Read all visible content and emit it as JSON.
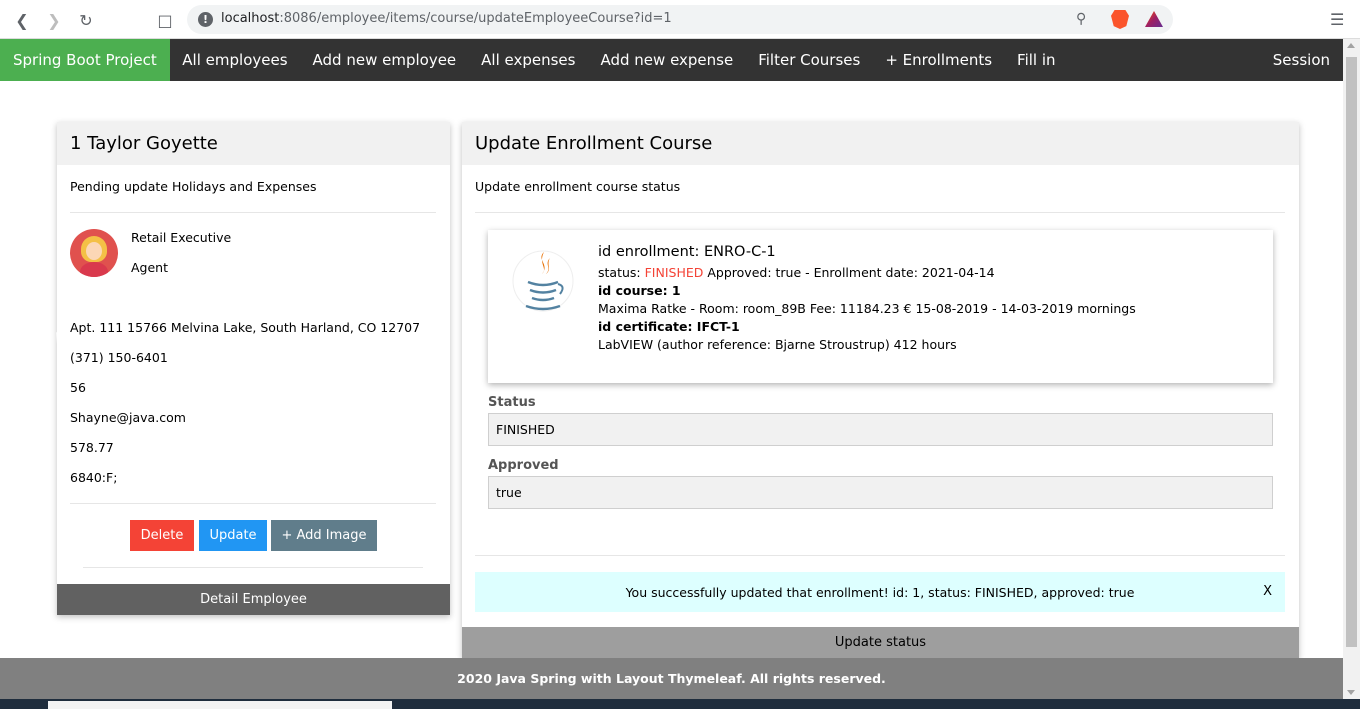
{
  "browser": {
    "url_host": "localhost",
    "url_path": ":8086/employee/items/course/updateEmployeeCourse?id=1"
  },
  "navbar": {
    "brand": "Spring Boot Project",
    "items": [
      "All employees",
      "Add new employee",
      "All expenses",
      "Add new expense",
      "Filter Courses",
      "+ Enrollments",
      "Fill in"
    ],
    "session": "Session"
  },
  "employee": {
    "title": "1 Taylor Goyette",
    "subtitle": "Pending update Holidays and Expenses",
    "role": "Retail Executive",
    "type": "Agent",
    "address": "Apt. 111 15766 Melvina Lake, South Harland, CO 12707",
    "phone": "(371) 150-6401",
    "age": "56",
    "email": "Shayne@java.com",
    "salary": "578.77",
    "code": "6840:F;",
    "buttons": {
      "delete": "Delete",
      "update": "Update",
      "add_image": "+ Add Image"
    },
    "footer": "Detail Employee"
  },
  "enrollment": {
    "title": "Update Enrollment Course",
    "subtitle": "Update enrollment course status",
    "id_label": "id enrollment: ENRO-C-1",
    "status_prefix": "status: ",
    "status_value": "FINISHED",
    "status_suffix": " Approved: true - Enrollment date: 2021-04-14",
    "course_label": "id course: 1",
    "course_detail": "Maxima Ratke - Room: room_89B Fee: 11184.23 € 15-08-2019 - 14-03-2019 mornings",
    "certificate_label": "id certificate: IFCT-1",
    "certificate_detail": "LabVIEW (author reference: Bjarne Stroustrup) 412 hours",
    "fields": {
      "status_label": "Status",
      "status_value": "FINISHED",
      "approved_label": "Approved",
      "approved_value": "true"
    },
    "alert": "You successfully updated that enrollment! id: 1, status: FINISHED, approved: true",
    "alert_close": "X",
    "submit": "Update status"
  },
  "footer": "2020 Java Spring with Layout Thymeleaf. All rights reserved."
}
